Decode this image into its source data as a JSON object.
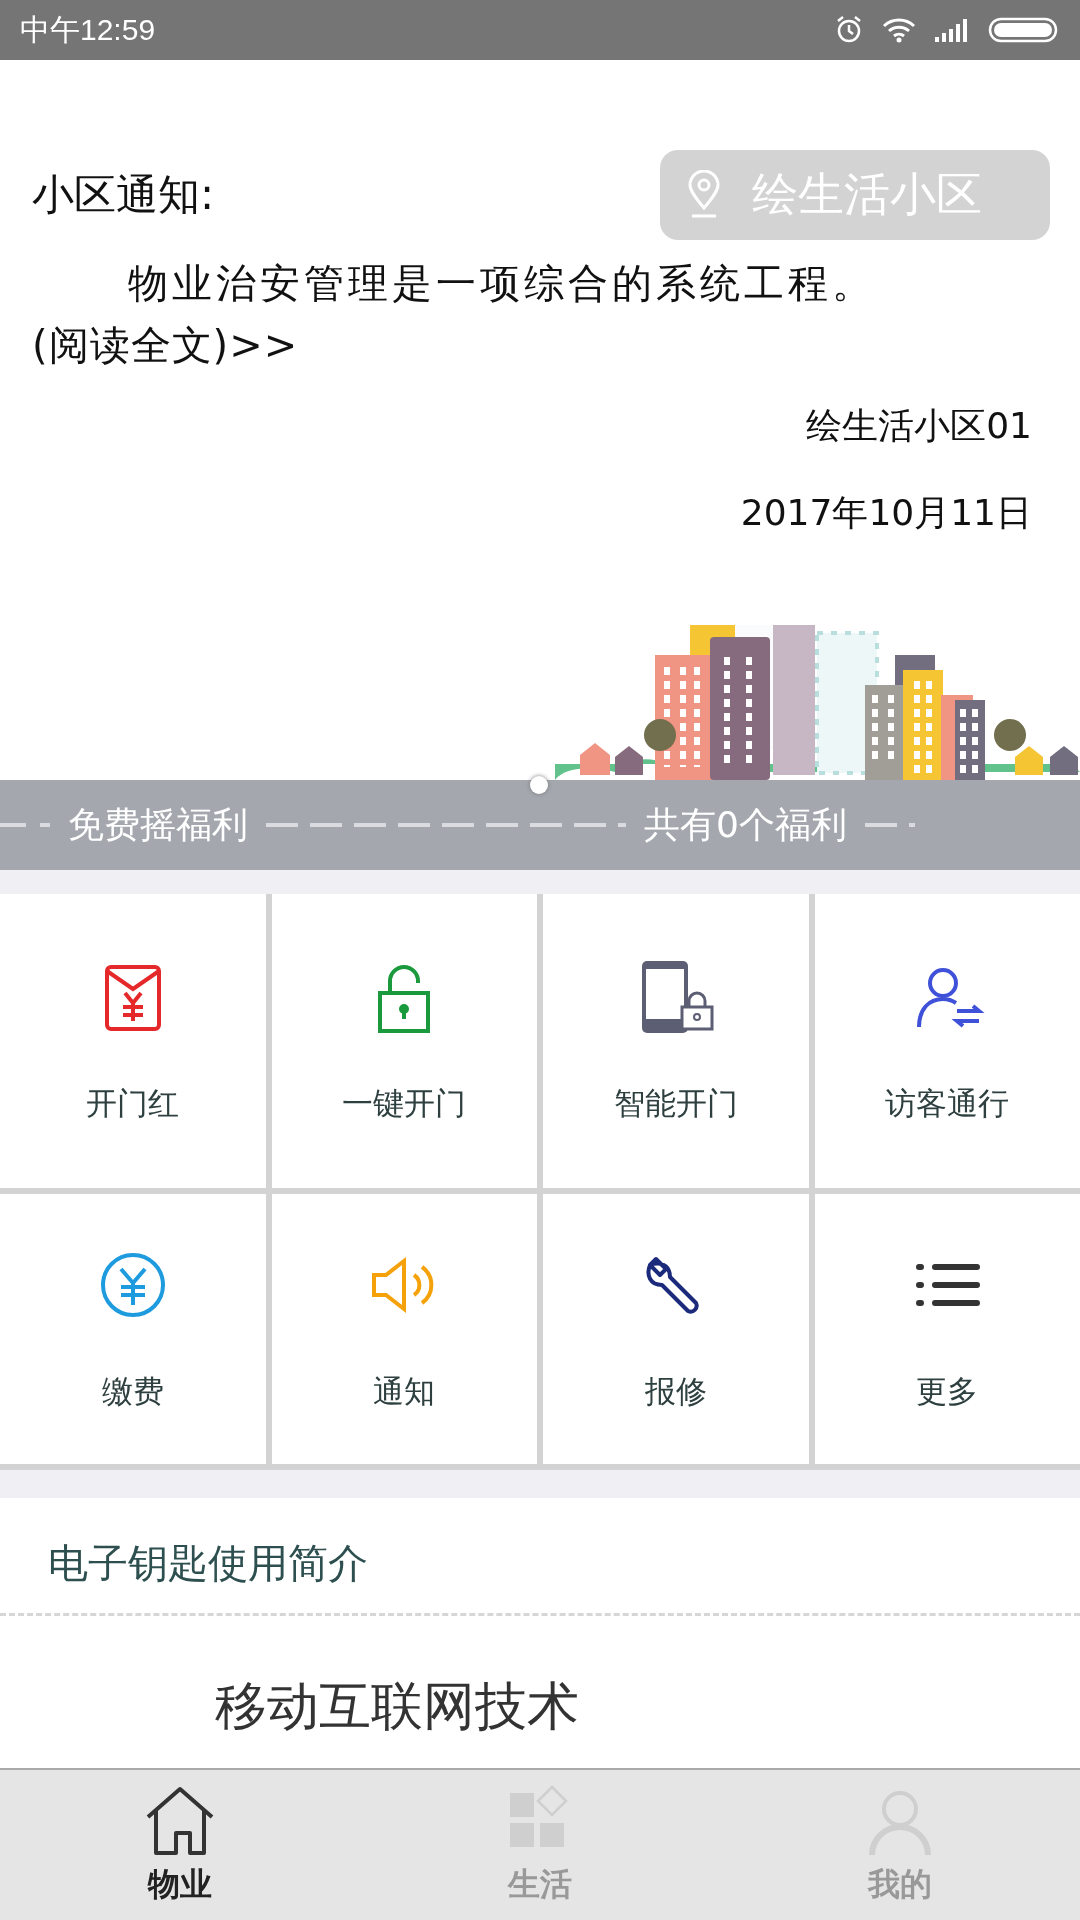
{
  "status_bar": {
    "time": "中午12:59"
  },
  "notice": {
    "title": "小区通知:",
    "location_button": "绘生活小区",
    "body": "物业治安管理是一项综合的系统工程。",
    "read_more": "(阅读全文)>>",
    "author": "绘生活小区01",
    "date": "2017年10月11日"
  },
  "banner_pages": [
    {
      "selected": true
    }
  ],
  "welfare_strip": {
    "left": "免费摇福利",
    "right": "共有0个福利"
  },
  "services": [
    {
      "kind": "redpacket",
      "label": "开门红",
      "color": "#e5282a"
    },
    {
      "kind": "lock",
      "label": "一键开门",
      "color": "#1a9a3c"
    },
    {
      "kind": "phone",
      "label": "智能开门",
      "color": "#5c5f73"
    },
    {
      "kind": "visitor",
      "label": "访客通行",
      "color": "#3f51d9"
    },
    {
      "kind": "yen",
      "label": "缴费",
      "color": "#1d9bde"
    },
    {
      "kind": "speaker",
      "label": "通知",
      "color": "#f5a20a"
    },
    {
      "kind": "wrench",
      "label": "报修",
      "color": "#1b2a7a"
    },
    {
      "kind": "list",
      "label": "更多",
      "color": "#333333"
    }
  ],
  "intro": {
    "title": "电子钥匙使用简介",
    "article_heading": "移动互联网技术"
  },
  "tabs": [
    {
      "kind": "home",
      "label": "物业",
      "selected": true
    },
    {
      "kind": "grid",
      "label": "生活",
      "selected": false
    },
    {
      "kind": "person",
      "label": "我的",
      "selected": false
    }
  ]
}
